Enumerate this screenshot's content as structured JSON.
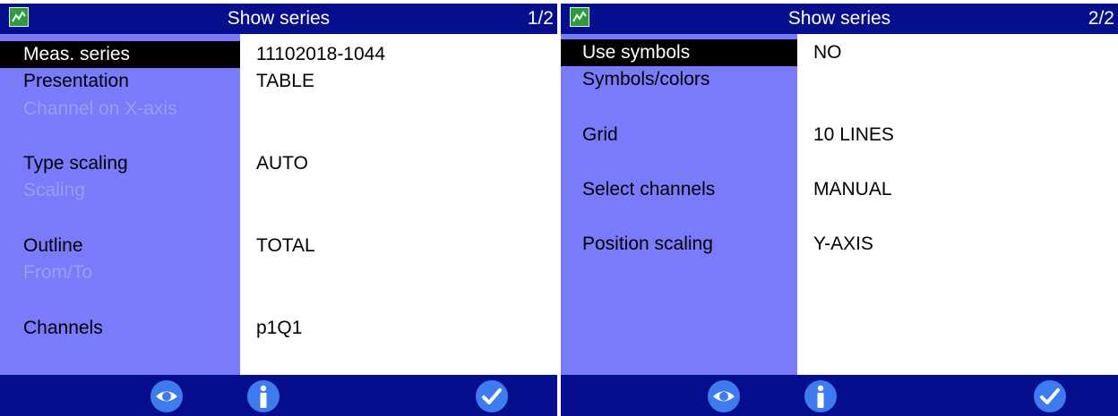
{
  "screens": [
    {
      "title": "Show series",
      "page": "1/2",
      "rows": [
        {
          "label": "Meas. series",
          "value": "11102018-1044",
          "state": "selected"
        },
        {
          "label": "Presentation",
          "value": "TABLE",
          "state": "normal"
        },
        {
          "label": "Channel on X-axis",
          "value": "",
          "state": "disabled"
        },
        {
          "label": "Type scaling",
          "value": "AUTO",
          "state": "normal"
        },
        {
          "label": "Scaling",
          "value": "",
          "state": "disabled"
        },
        {
          "label": "Outline",
          "value": "TOTAL",
          "state": "normal"
        },
        {
          "label": "From/To",
          "value": "",
          "state": "disabled"
        },
        {
          "label": "Channels",
          "value": "p1Q1",
          "state": "normal"
        }
      ]
    },
    {
      "title": "Show series",
      "page": "2/2",
      "rows": [
        {
          "label": "Use symbols",
          "value": "NO",
          "state": "selected"
        },
        {
          "label": "Symbols/colors",
          "value": "",
          "state": "normal"
        },
        {
          "label": "Grid",
          "value": "10 LINES",
          "state": "normal"
        },
        {
          "label": "Select channels",
          "value": "MANUAL",
          "state": "normal"
        },
        {
          "label": "Position scaling",
          "value": "Y-AXIS",
          "state": "normal"
        }
      ]
    }
  ],
  "footer_buttons": [
    {
      "icon": "eye-icon"
    },
    {
      "icon": "info-icon"
    },
    {
      "icon": "checkmark-icon"
    }
  ],
  "colors": {
    "title_bar": "#050f8e",
    "label_column": "#7a7bfa",
    "selected_row": "#000000",
    "disabled_text": "#9c9cf0",
    "button_fill": "#3d7bf0"
  }
}
